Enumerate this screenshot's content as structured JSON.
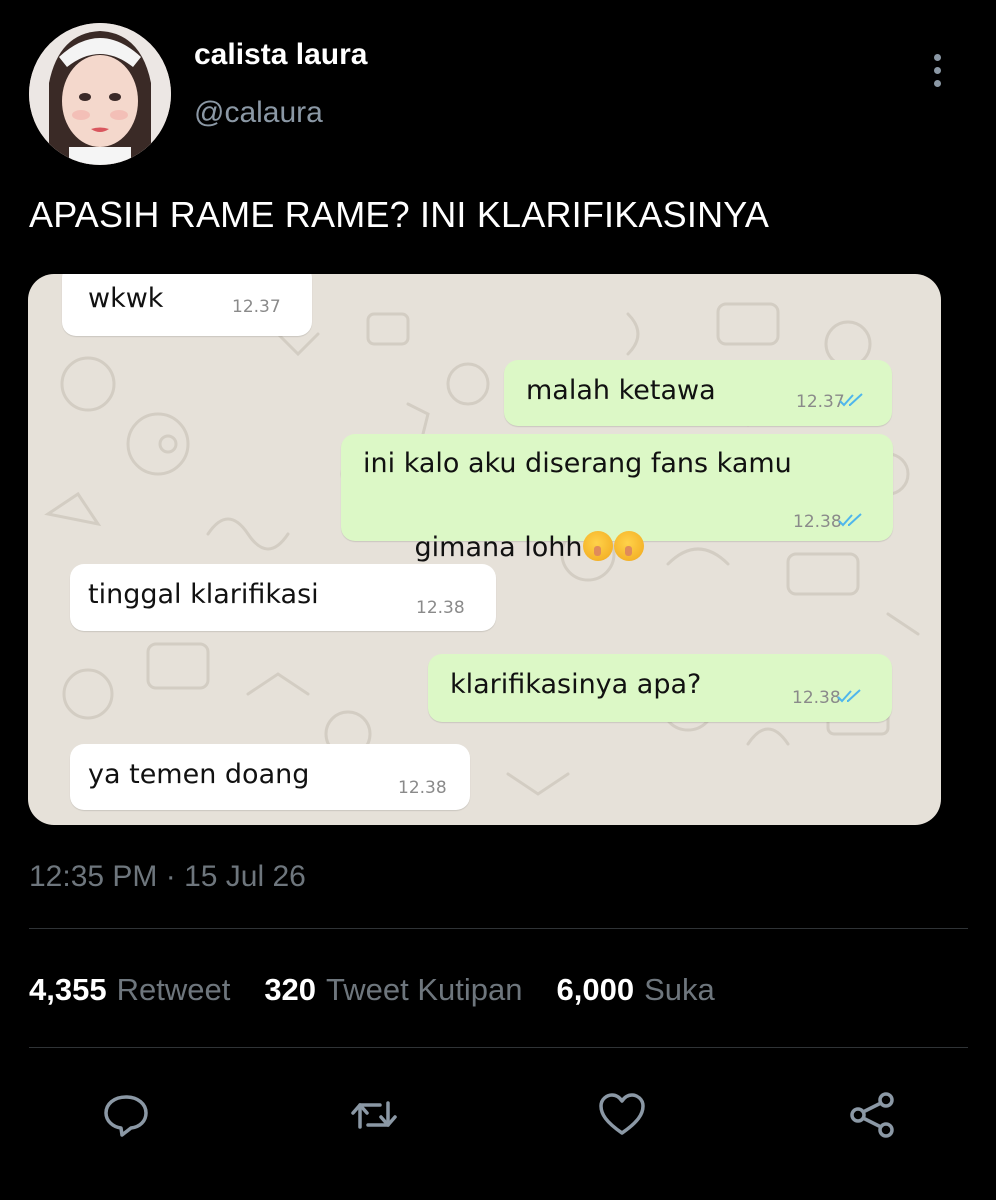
{
  "author": {
    "display_name": "calista laura",
    "handle": "@calaura"
  },
  "tweet": {
    "text": "APASIH RAME RAME? INI KLARIFIKASINYA",
    "timestamp": "12:35 PM · 15 Jul 26"
  },
  "chat": {
    "messages": [
      {
        "direction": "in",
        "text": "wkwk",
        "time": "12.37"
      },
      {
        "direction": "out",
        "text": "malah ketawa",
        "time": "12.37",
        "read": true
      },
      {
        "direction": "out",
        "text_line1": "ini kalo aku diserang fans kamu",
        "text_line2": "gimana lohh",
        "emojis": [
          "shushing-face",
          "shushing-face"
        ],
        "time": "12.38",
        "read": true
      },
      {
        "direction": "in",
        "text": "tinggal klarifikasi",
        "time": "12.38"
      },
      {
        "direction": "out",
        "text": "klarifikasinya apa?",
        "time": "12.38",
        "read": true
      },
      {
        "direction": "in",
        "text": "ya temen doang",
        "time": "12.38"
      }
    ]
  },
  "stats": {
    "retweets": {
      "count": "4,355",
      "label": "Retweet"
    },
    "quotes": {
      "count": "320",
      "label": "Tweet Kutipan"
    },
    "likes": {
      "count": "6,000",
      "label": "Suka"
    }
  },
  "actions": [
    "reply-icon",
    "retweet-icon",
    "like-icon",
    "share-icon"
  ],
  "colors": {
    "background": "#000000",
    "secondary_text": "#8b98a5",
    "incoming_bubble": "#ffffff",
    "outgoing_bubble": "#dcf8c6",
    "read_ticks": "#4fb6ec"
  }
}
